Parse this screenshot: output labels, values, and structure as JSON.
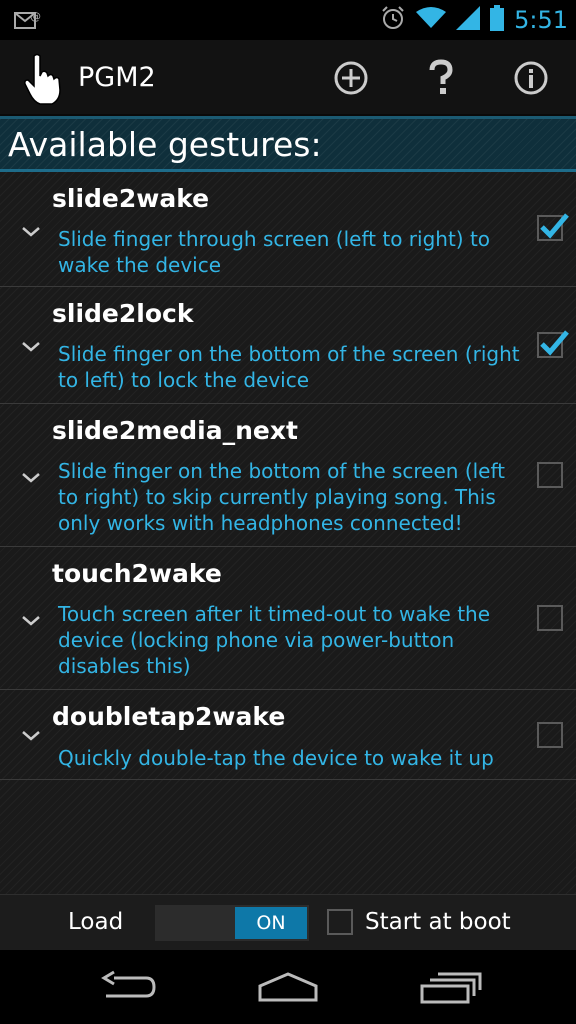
{
  "status_bar": {
    "time": "5:51",
    "icons": [
      "email-notification-icon",
      "alarm-icon",
      "wifi-icon",
      "signal-icon",
      "battery-icon"
    ]
  },
  "action_bar": {
    "title": "PGM2",
    "icons": [
      "hand-pointer-icon",
      "add-circle-icon",
      "help-icon",
      "info-icon"
    ]
  },
  "section": {
    "title": "Available gestures:"
  },
  "gestures": [
    {
      "name": "slide2wake",
      "description": "Slide finger through screen (left to right) to wake the device",
      "checked": true
    },
    {
      "name": "slide2lock",
      "description": "Slide finger on the bottom of the screen (right to left) to lock the device",
      "checked": true
    },
    {
      "name": "slide2media_next",
      "description": "Slide finger on the bottom of the screen (left to right) to skip currently playing song. This only works with headphones connected!",
      "checked": false
    },
    {
      "name": "touch2wake",
      "description": "Touch screen after it timed-out to wake the device (locking phone via power-button disables this)",
      "checked": false
    },
    {
      "name": "doubletap2wake",
      "description": "Quickly double-tap the device to wake it up",
      "checked": false
    }
  ],
  "controls": {
    "load_label": "Load",
    "toggle_state": "ON",
    "start_at_boot_label": "Start at boot",
    "start_at_boot_checked": false
  },
  "colors": {
    "accent": "#33b5e5",
    "toggle_on": "#0e78a8"
  },
  "nav_bar": {
    "icons": [
      "back-icon",
      "home-icon",
      "recent-apps-icon"
    ]
  }
}
